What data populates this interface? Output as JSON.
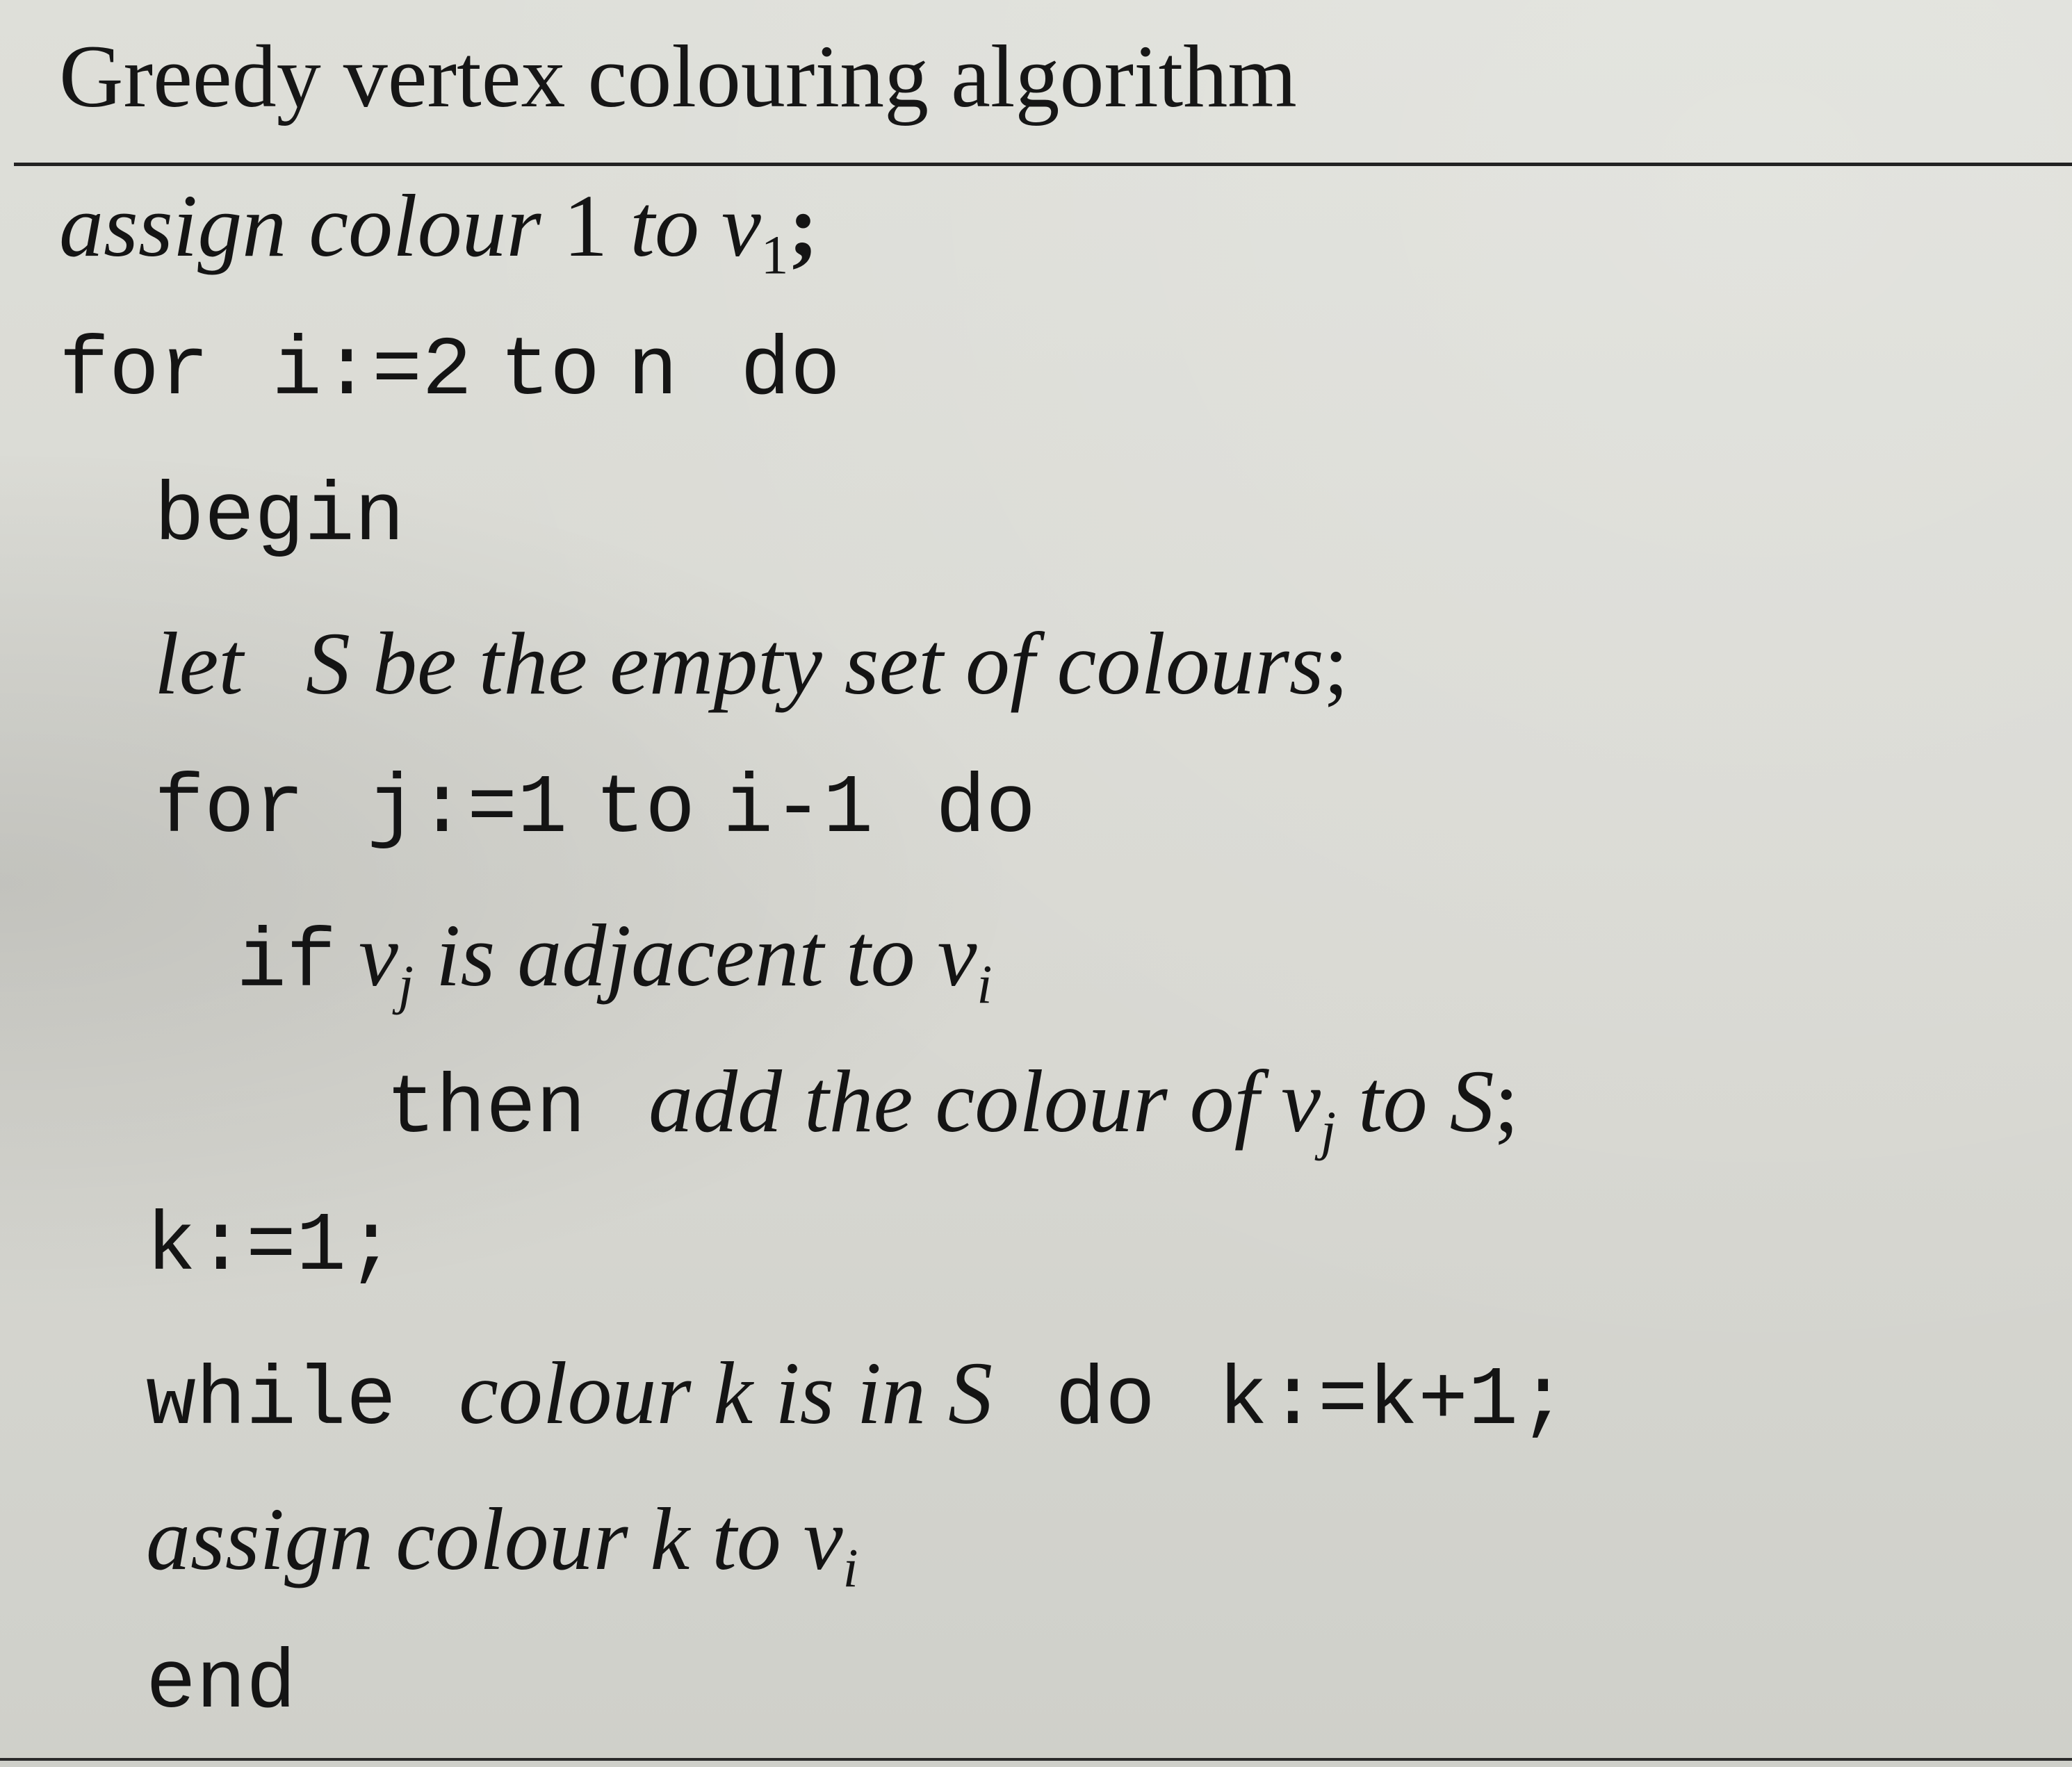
{
  "heading": "Greedy vertex colouring algorithm",
  "lines": {
    "l1": {
      "italic_text": "assign colour",
      "num": "1",
      "to_text": "to v",
      "sub": "1",
      "end": ";"
    },
    "l2": {
      "kw_for": "for",
      "var": "i:=2",
      "kw_to": "to",
      "n": "n",
      "kw_do": "do"
    },
    "l3": {
      "kw": "begin"
    },
    "l4": {
      "kw_let": "let",
      "text": "S be the empty set of colours",
      "end": ";"
    },
    "l5": {
      "kw_for": "for",
      "var": "j:=1",
      "kw_to": "to",
      "expr": "i-1",
      "kw_do": "do"
    },
    "l6": {
      "kw_if": "if",
      "v": "v",
      "sub_j": "j",
      "text": "is adjacent to v",
      "sub_i": "i"
    },
    "l7": {
      "kw_then": "then",
      "text": "add the colour of v",
      "sub_j": "j",
      "to_s": "to S",
      "end": ";"
    },
    "l8": {
      "stmt": "k:=1;"
    },
    "l9": {
      "kw_while": "while",
      "text": "colour k is in S",
      "kw_do": "do",
      "stmt": "k:=k+1;"
    },
    "l10": {
      "text": "assign colour k to v",
      "sub_i": "i"
    },
    "l11": {
      "kw": "end"
    }
  }
}
